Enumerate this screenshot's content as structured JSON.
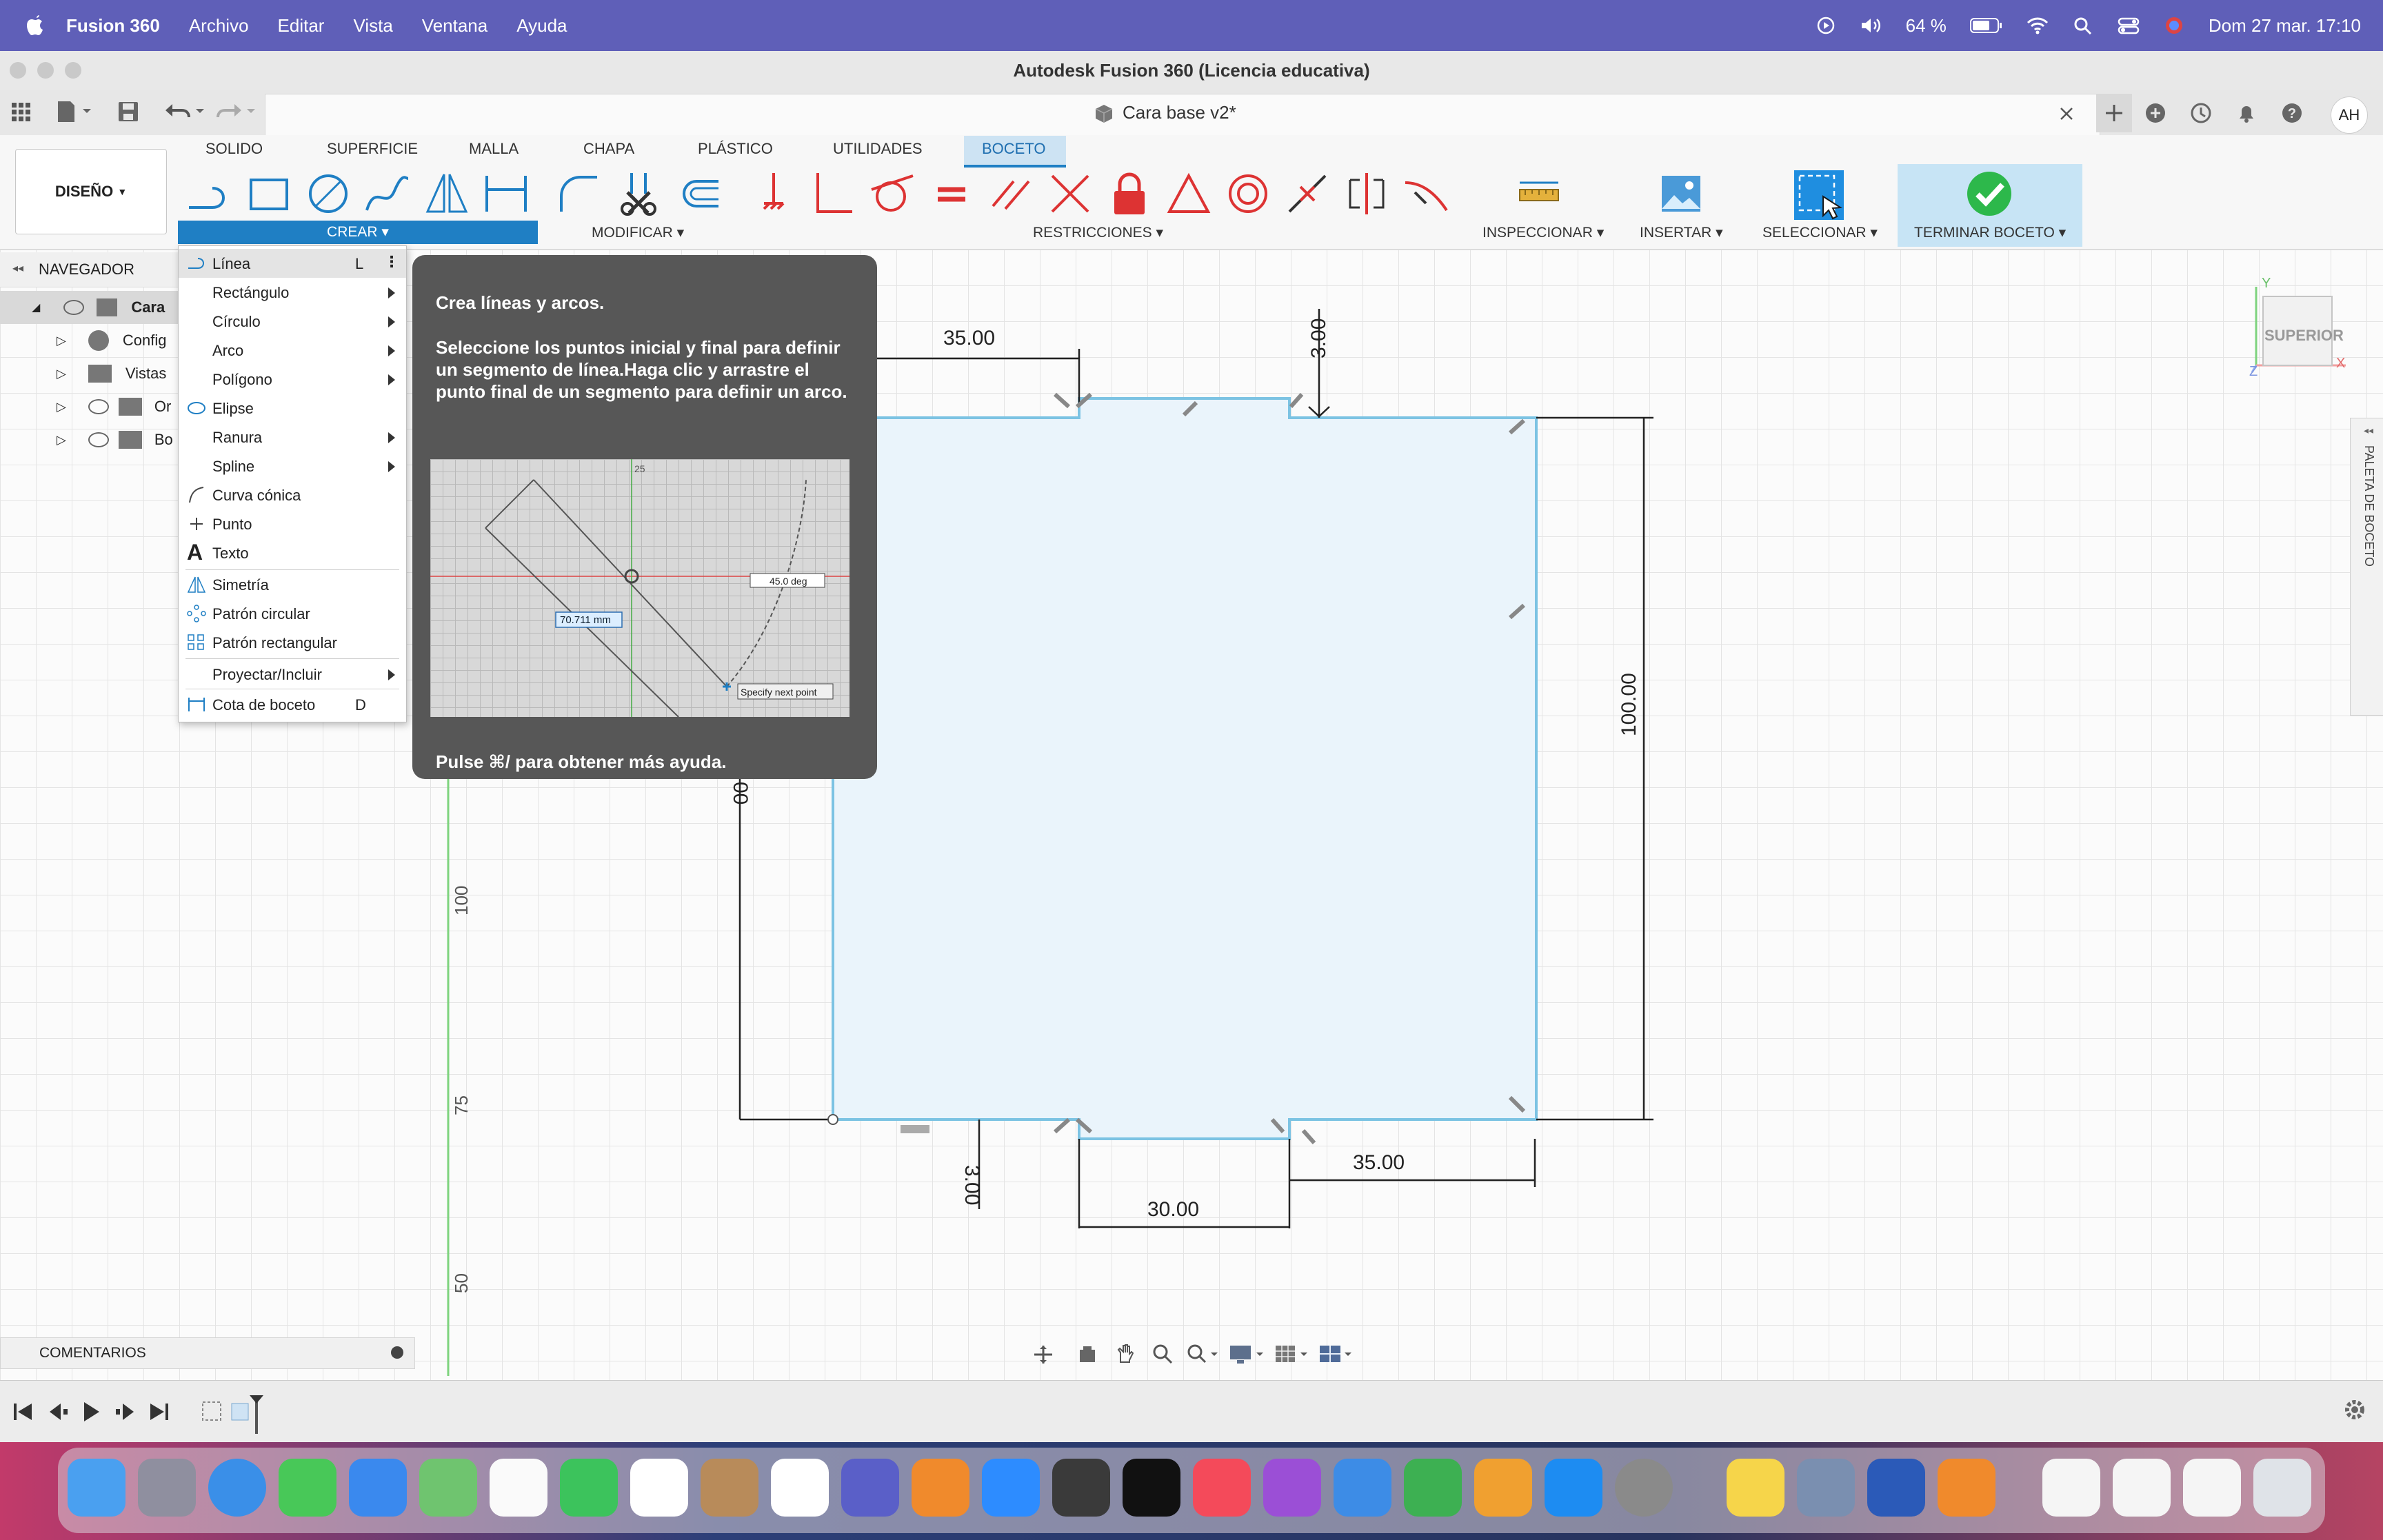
{
  "menubar": {
    "app": "Fusion 360",
    "items": [
      "Archivo",
      "Editar",
      "Vista",
      "Ventana",
      "Ayuda"
    ],
    "battery": "64 %",
    "datetime": "Dom 27 mar.  17:10"
  },
  "window": {
    "title": "Autodesk Fusion 360 (Licencia educativa)",
    "document": "Cara base v2*",
    "user_initials": "AH"
  },
  "ribbon": {
    "workspace": "DISEÑO",
    "tabs": [
      "SOLIDO",
      "SUPERFICIE",
      "MALLA",
      "CHAPA",
      "PLÁSTICO",
      "UTILIDADES",
      "BOCETO"
    ],
    "active_tab": "BOCETO",
    "groups": {
      "crear": "CREAR",
      "modificar": "MODIFICAR",
      "restricciones": "RESTRICCIONES",
      "inspeccionar": "INSPECCIONAR",
      "insertar": "INSERTAR",
      "seleccionar": "SELECCIONAR",
      "terminar": "TERMINAR BOCETO"
    }
  },
  "navigator": {
    "title": "NAVEGADOR",
    "rows": [
      "Cara",
      "Config",
      "Vistas",
      "Or",
      "Bo"
    ]
  },
  "create_menu": {
    "items": [
      {
        "label": "Línea",
        "shortcut": "L"
      },
      {
        "label": "Rectángulo"
      },
      {
        "label": "Círculo"
      },
      {
        "label": "Arco"
      },
      {
        "label": "Polígono"
      },
      {
        "label": "Elipse"
      },
      {
        "label": "Ranura"
      },
      {
        "label": "Spline"
      },
      {
        "label": "Curva cónica"
      },
      {
        "label": "Punto"
      },
      {
        "label": "Texto"
      },
      {
        "label": "Simetría"
      },
      {
        "label": "Patrón circular"
      },
      {
        "label": "Patrón rectangular"
      },
      {
        "label": "Proyectar/Incluir"
      },
      {
        "label": "Cota de boceto",
        "shortcut": "D"
      }
    ]
  },
  "tooltip": {
    "title": "Crea líneas y arcos.",
    "description": "Seleccione los puntos inicial y final para definir un segmento de línea.Haga clic y arrastre el punto final de un segmento para definir un arco.",
    "footer": "Pulse ⌘/ para obtener más ayuda.",
    "preview": {
      "length": "70.711 mm",
      "angle": "45.0 deg",
      "prompt": "Specify next point",
      "tick": "25"
    }
  },
  "viewcube": {
    "face": "SUPERIOR",
    "axis_x": "X",
    "axis_y": "Y",
    "axis_z": "Z"
  },
  "palette_label": "PALETA DE BOCETO",
  "comments": "COMENTARIOS",
  "ruler": {
    "v1": "100",
    "v2": "75",
    "v3": "50"
  },
  "dimensions": {
    "top_left": "35.00",
    "top_notch": "3.00",
    "right": "100.00",
    "left_partial": "00",
    "bottom_notch": "3.00",
    "bottom_mid": "30.00",
    "bottom_right": "35.00"
  },
  "colors": {
    "menubar": "#5f5fb8",
    "accent": "#1f7fc4",
    "sketch_fill": "#eaf4fb",
    "sketch_line": "#7cc3e3",
    "tooltip_bg": "#575757",
    "finish_green": "#2db84b"
  }
}
